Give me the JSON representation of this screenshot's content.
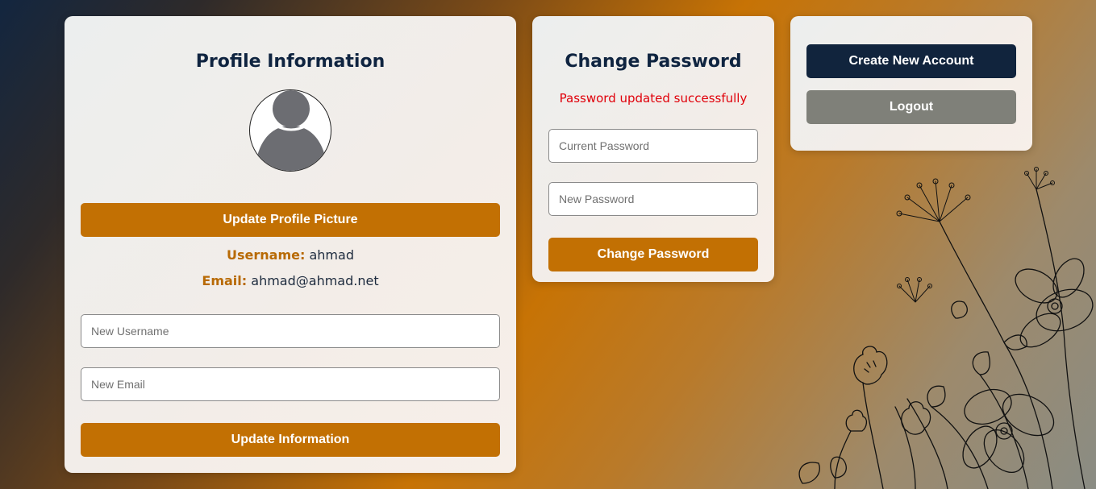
{
  "profile": {
    "title": "Profile Information",
    "update_picture_label": "Update Profile Picture",
    "username_label": "Username:",
    "username_value": "ahmad",
    "email_label": "Email:",
    "email_value": "ahmad@ahmad.net",
    "new_username_placeholder": "New Username",
    "new_email_placeholder": "New Email",
    "update_info_label": "Update Information"
  },
  "password": {
    "title": "Change Password",
    "status_message": "Password updated successfully",
    "status_color": "#e0000a",
    "current_password_placeholder": "Current Password",
    "new_password_placeholder": "New Password",
    "change_password_label": "Change Password"
  },
  "account": {
    "create_account_label": "Create New Account",
    "logout_label": "Logout"
  },
  "colors": {
    "accent_orange": "#c27003",
    "navy": "#11243d",
    "grey_button": "#7f8079"
  },
  "icons": {
    "avatar": "user-silhouette-icon",
    "decoration": "wildflower-line-art"
  }
}
